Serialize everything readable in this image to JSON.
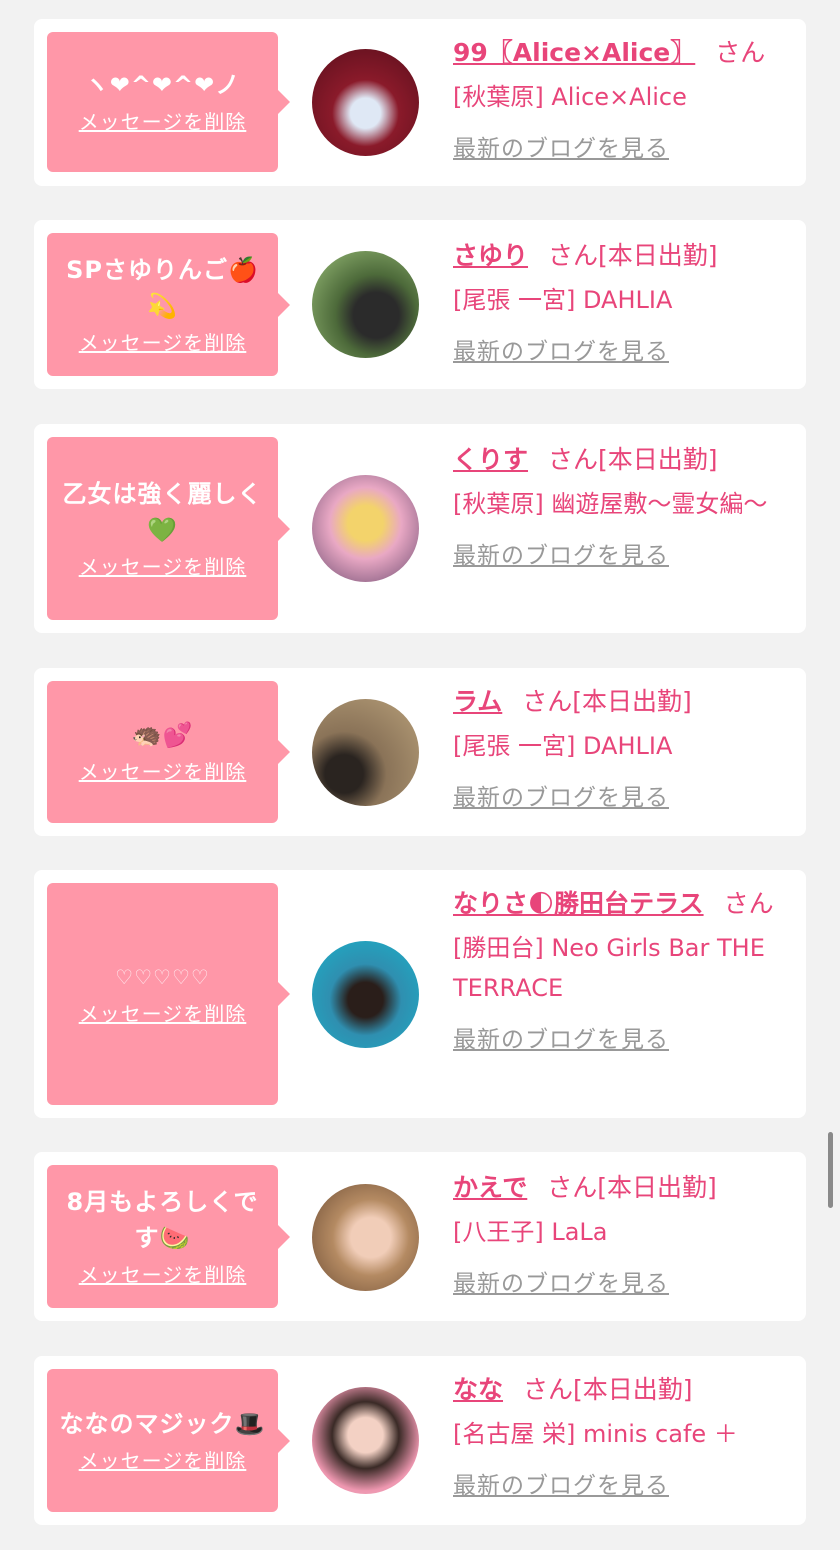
{
  "favorites": [
    {
      "message": "ヽ❤︎^❤︎^❤︎ノ",
      "delete_label": "メッセージを削除",
      "name": "99〖Alice×Alice〗",
      "honorific": "さん",
      "status": "",
      "shop": "[秋葉原] Alice×Alice",
      "blog_label": "最新のブログを見る",
      "avatar": "avatar-photo"
    },
    {
      "message": "SPさゆりんご🍎💫",
      "delete_label": "メッセージを削除",
      "name": "さゆり",
      "honorific": "さん",
      "status": "[本日出勤]",
      "shop": "[尾張 一宮] DAHLIA",
      "blog_label": "最新のブログを見る",
      "avatar": "avatar-photo"
    },
    {
      "message": "乙女は強く麗しく💚",
      "delete_label": "メッセージを削除",
      "name": "くりす",
      "honorific": "さん",
      "status": "[本日出勤]",
      "shop": "[秋葉原] 幽遊屋敷〜霊女編〜",
      "blog_label": "最新のブログを見る",
      "avatar": "avatar-photo"
    },
    {
      "message": "🦔💕",
      "delete_label": "メッセージを削除",
      "name": "ラム",
      "honorific": "さん",
      "status": "[本日出勤]",
      "shop": "[尾張 一宮] DAHLIA",
      "blog_label": "最新のブログを見る",
      "avatar": "avatar-photo"
    },
    {
      "message": "♡♡♡♡♡",
      "delete_label": "メッセージを削除",
      "name": "なりさ🌓勝田台テラス",
      "honorific": "さん",
      "status": "",
      "shop": "[勝田台] Neo Girls Bar THE TERRACE",
      "blog_label": "最新のブログを見る",
      "avatar": "avatar-photo"
    },
    {
      "message": "8月もよろしくです🍉",
      "delete_label": "メッセージを削除",
      "name": "かえで",
      "honorific": "さん",
      "status": "[本日出勤]",
      "shop": "[八王子] LaLa",
      "blog_label": "最新のブログを見る",
      "avatar": "avatar-photo"
    },
    {
      "message": "ななのマジック🎩",
      "delete_label": "メッセージを削除",
      "name": "なな",
      "honorific": "さん",
      "status": "[本日出勤]",
      "shop": "[名古屋 栄] minis cafe ＋",
      "blog_label": "最新のブログを見る",
      "avatar": "avatar-photo"
    }
  ],
  "colors": {
    "accent": "#e8457a",
    "bubble": "#ff97a8",
    "muted": "#999999",
    "background": "#f2f2f2"
  }
}
